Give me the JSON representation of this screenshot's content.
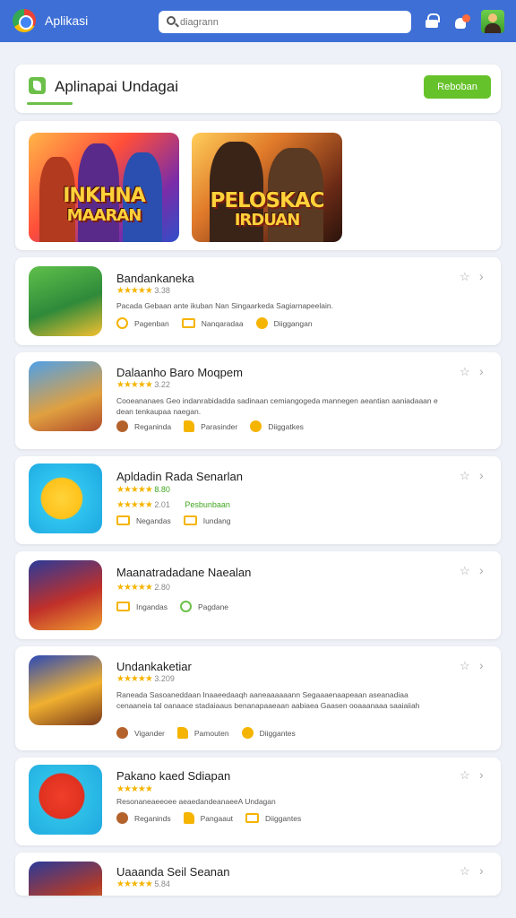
{
  "topbar": {
    "app_title": "Aplikasi",
    "search_placeholder": "diagrann"
  },
  "header": {
    "title": "Aplinapai Undagai",
    "action_label": "Reboban"
  },
  "featured": [
    {
      "line1": "INKHNA",
      "line2": "MAARAN"
    },
    {
      "line1": "PELOSKAC",
      "line2": "IRDUAN"
    }
  ],
  "apps": [
    {
      "name": "Bandankaneka",
      "stars_text": "★★★★★",
      "rating_value": "3.38",
      "description": "Pacada Gebaan ante ikuban Nan Singaarkeda Sagiarnapeelain.",
      "meta": [
        "Pagenban",
        "Nanqaradaa",
        "Diiggangan"
      ]
    },
    {
      "name": "Dalaanho Baro Moqpem",
      "stars_text": "★★★★★",
      "rating_value": "3.22",
      "description": "Cooeananaes Geo indanrabidadda sadinaan cemiangogeda mannegen aeantian aaniadaaan e dean tenkaupaa naegan.",
      "meta": [
        "Reganinda",
        "Parasinder",
        "Diiggatkes"
      ]
    },
    {
      "name": "Apldadin Rada Senarlan",
      "stars_text": "★★★★★",
      "rating_value": "8.80",
      "rating_row2_value": "2.01",
      "rating_row2_label": "Pesbunbaan",
      "meta": [
        "Negandas",
        "Iundang"
      ]
    },
    {
      "name": "Maanatradadane Naealan",
      "stars_text": "★★★★★",
      "rating_value": "2.80",
      "meta": [
        "Ingandas",
        "Pagdane"
      ]
    },
    {
      "name": "Undankaketiar",
      "stars_text": "★★★★★",
      "rating_value": "3.209",
      "description": "Raneada Sasoaneddaan Inaaeedaaqh aaneaaaaaann Segaaaenaapeaan aseanadiaa cenaaneia tal oanaace stadaiaaus benanapaaeaan aabiaea Gaasen ooaaanaaa saaiaiiah",
      "meta": [
        "Vigander",
        "Pamouten",
        "Diiggantes"
      ]
    },
    {
      "name": "Pakano kaed Sdiapan",
      "stars_text": "★★★★★",
      "rating_value": "",
      "description": "Resonaneaeeoee aeaedandeanaeeA Undagan",
      "meta": [
        "Reganinds",
        "Pangaaut",
        "Diiggantes"
      ]
    },
    {
      "name": "Uaaanda Seil Seanan",
      "stars_text": "★★★★★",
      "rating_value": "5.84"
    }
  ]
}
